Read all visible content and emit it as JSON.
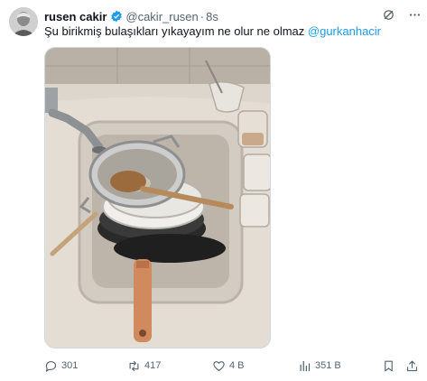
{
  "tweet": {
    "author": {
      "name": "rusen cakir",
      "handle": "@cakir_rusen",
      "separator": "·",
      "time": "8s"
    },
    "text_before": "Şu birikmiş bulaşıkları yıkayayım ne olur ne olmaz ",
    "mention": "@gurkanhacir",
    "media": {
      "alt_icon": "photo-of-dishes-in-sink"
    },
    "header_icons": [
      "grok-icon",
      "more-icon"
    ],
    "metrics": {
      "replies": "301",
      "reposts": "417",
      "likes": "4 B",
      "views": "351 B"
    },
    "colors": {
      "accent": "#1d9bf0",
      "muted": "#536471",
      "text": "#0f1419"
    }
  }
}
